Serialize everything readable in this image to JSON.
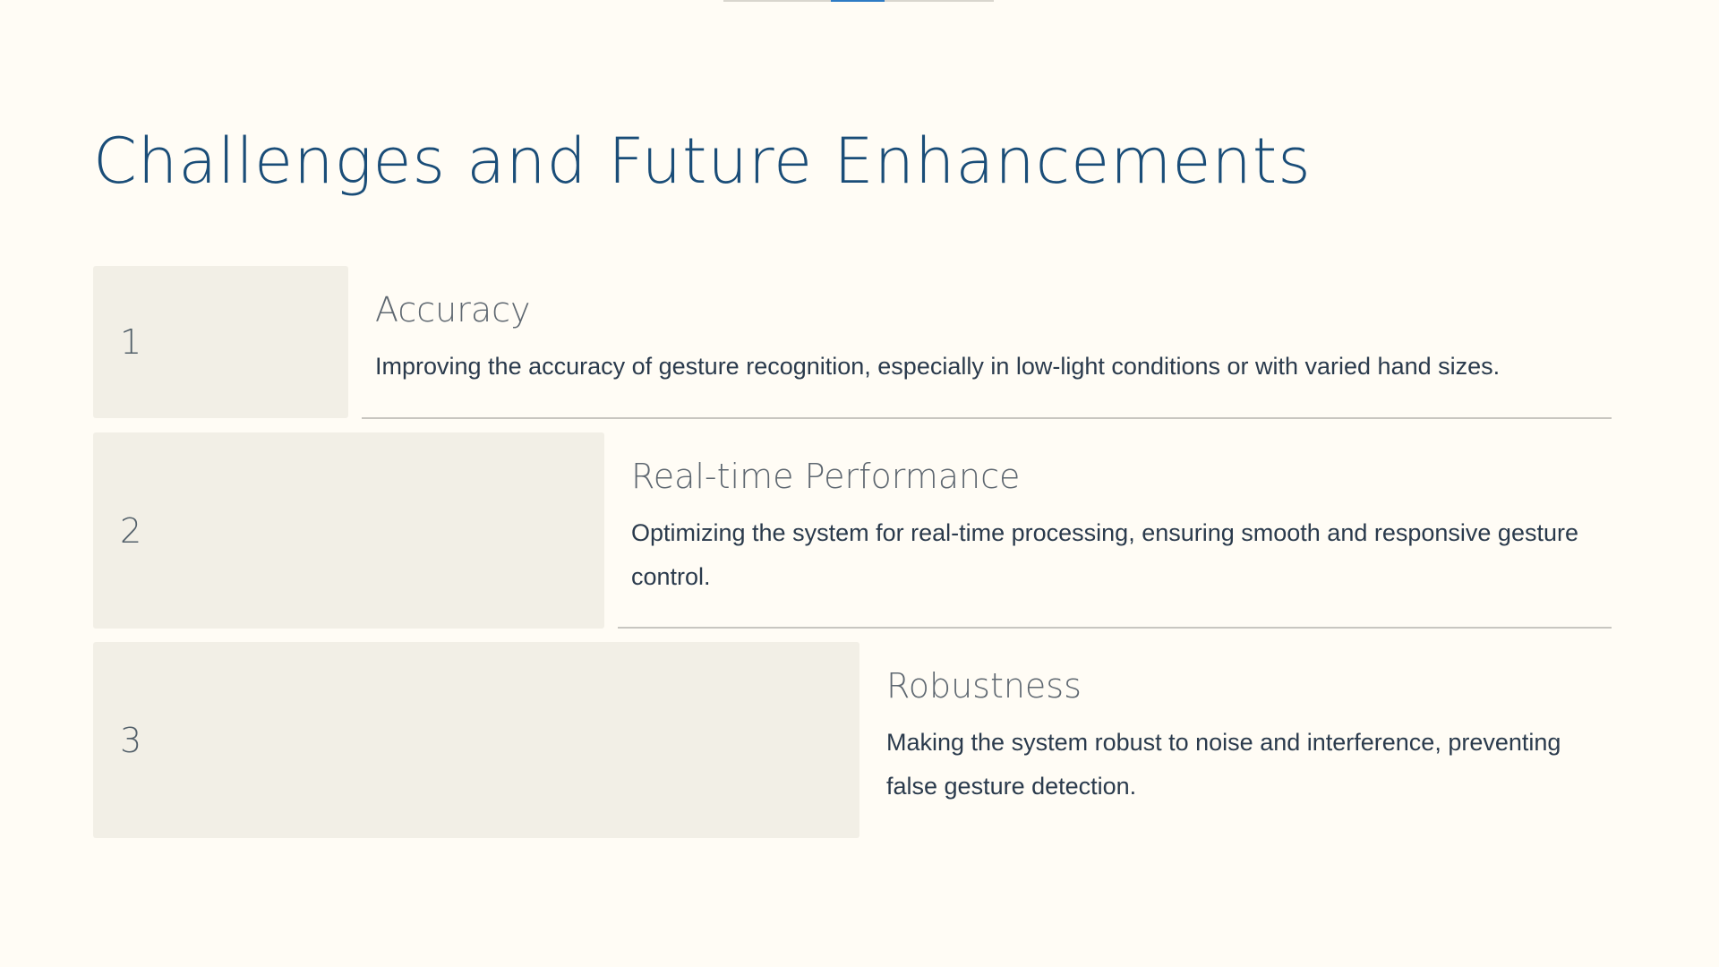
{
  "slide": {
    "title": "Challenges and Future Enhancements"
  },
  "progress": {
    "fraction": 0.2
  },
  "steps": [
    {
      "number": "1",
      "heading": "Accuracy",
      "text": "Improving the accuracy of gesture recognition, especially in low-light conditions or with varied hand sizes."
    },
    {
      "number": "2",
      "heading": "Real-time Performance",
      "text": "Optimizing the system for real-time processing, ensuring smooth and responsive gesture control."
    },
    {
      "number": "3",
      "heading": "Robustness",
      "text": "Making the system robust to noise and interference, preventing false gesture detection."
    }
  ],
  "colors": {
    "background": "#fffcf5",
    "title": "#1a4d78",
    "accent": "#2e7bc4",
    "box": "#f2efe6"
  }
}
